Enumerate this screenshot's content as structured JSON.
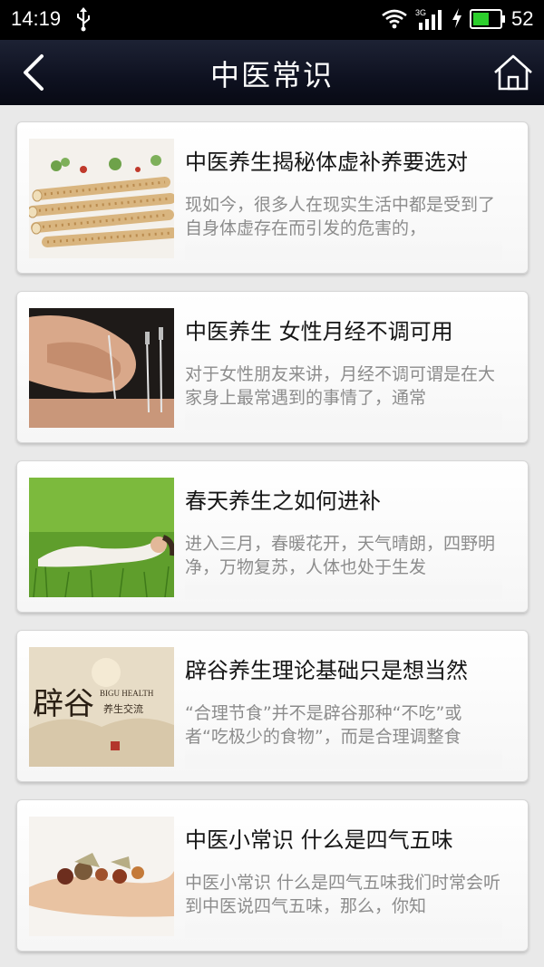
{
  "status": {
    "time": "14:19",
    "network": "3G",
    "battery": "52"
  },
  "header": {
    "title": "中医常识"
  },
  "colors": {
    "header_bg": "#0e1120",
    "card_bg": "#ffffff",
    "list_bg": "#e9e9e9",
    "battery_green": "#2ccf2c"
  },
  "articles": [
    {
      "title": "中医养生揭秘体虚补养要选对",
      "summary": "现如今，很多人在现实生活中都是受到了自身体虚存在而引发的危害的，",
      "image": "herbal-root-slices"
    },
    {
      "title": "中医养生 女性月经不调可用",
      "summary": "对于女性朋友来讲，月经不调可谓是在大家身上最常遇到的事情了，通常",
      "image": "acupuncture-needles"
    },
    {
      "title": "春天养生之如何进补",
      "summary": "进入三月，春暖花开，天气晴朗，四野明净，万物复苏，人体也处于生发",
      "image": "woman-lying-in-grass"
    },
    {
      "title": "辟谷养生理论基础只是想当然",
      "summary": "“合理节食”并不是辟谷那种“不吃”或者“吃极少的食物”，而是合理调整食",
      "image": "bigu-health-poster",
      "image_text": {
        "main": "辟谷",
        "en": "BIGU HEALTH",
        "sub": "养生交流"
      }
    },
    {
      "title": "中医小常识 什么是四气五味",
      "summary": "中医小常识 什么是四气五味我们时常会听到中医说四气五味，那么，你知",
      "image": "herbs-in-hand"
    }
  ]
}
